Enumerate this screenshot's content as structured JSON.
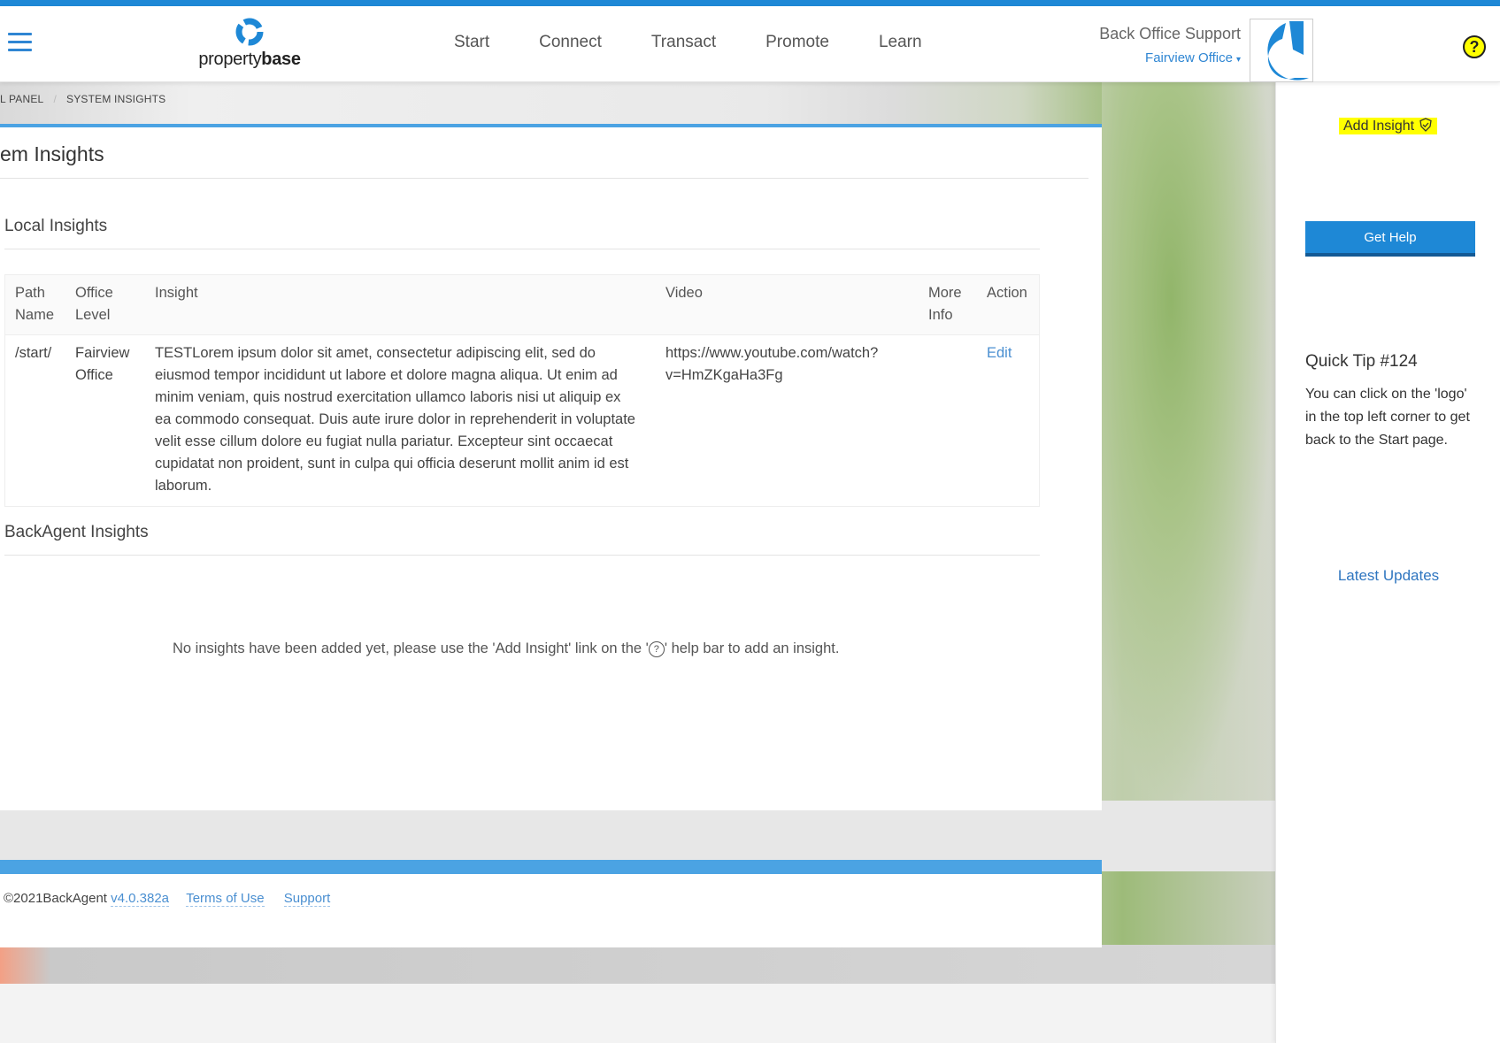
{
  "header": {
    "logo_text_light": "property",
    "logo_text_bold": "base",
    "nav": [
      "Start",
      "Connect",
      "Transact",
      "Promote",
      "Learn"
    ],
    "user_name": "Back Office Support",
    "office": "Fairview Office",
    "office_caret": "▾",
    "help_icon": "?"
  },
  "breadcrumb": {
    "items": [
      "L PANEL",
      "SYSTEM INSIGHTS"
    ],
    "separator": "/"
  },
  "panel": {
    "title": "em Insights",
    "local_section_title": "Local Insights",
    "table": {
      "headers": {
        "path_1": "Path",
        "path_2": "Name",
        "office_1": "Office",
        "office_2": "Level",
        "insight": "Insight",
        "video": "Video",
        "more_1": "More",
        "more_2": "Info",
        "action": "Action"
      },
      "rows": [
        {
          "path": "/start/",
          "office_1": "Fairview",
          "office_2": "Office",
          "insight": "TESTLorem ipsum dolor sit amet, consectetur adipiscing elit, sed do eiusmod tempor incididunt ut labore et dolore magna aliqua. Ut enim ad minim veniam, quis nostrud exercitation ullamco laboris nisi ut aliquip ex ea commodo consequat. Duis aute irure dolor in reprehenderit in voluptate velit esse cillum dolore eu fugiat nulla pariatur. Excepteur sint occaecat cupidatat non proident, sunt in culpa qui officia deserunt mollit anim id est laborum.",
          "video_1": "https://www.youtube.com/watch?",
          "video_2": "v=HmZKgaHa3Fg",
          "more_info": "",
          "action": "Edit"
        }
      ]
    },
    "backagent_section_title": "BackAgent Insights",
    "empty_before": "No insights have been added yet, please use the 'Add Insight' link on the '",
    "empty_icon": "?",
    "empty_after": "' help bar to add an insight."
  },
  "footer": {
    "copyright": "©2021BackAgent ",
    "version": "v4.0.382a",
    "terms": "Terms of Use",
    "support": "Support"
  },
  "sidebar": {
    "add_insight": "Add Insight",
    "get_help": "Get Help",
    "tip_title": "Quick Tip #124",
    "tip_body": "You can click on the 'logo' in the top left corner to get back to the Start page.",
    "latest_updates": "Latest Updates"
  },
  "colors": {
    "accent": "#1e88d6",
    "highlight": "#ffff00",
    "link": "#4a8fd1"
  }
}
